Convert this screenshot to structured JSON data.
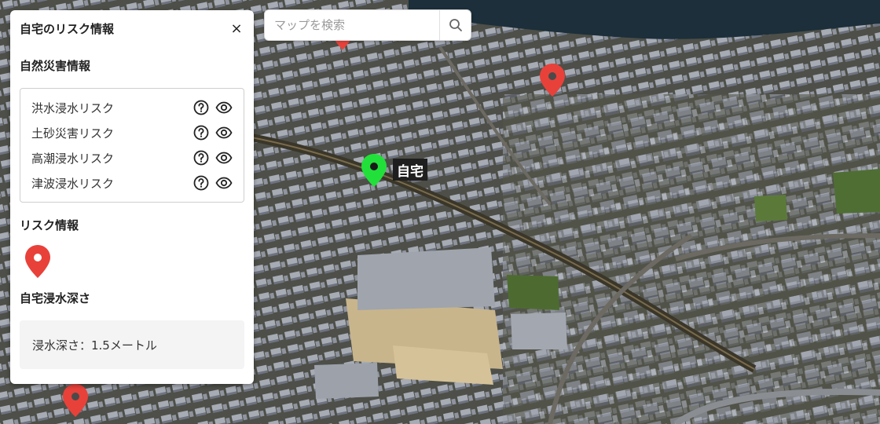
{
  "search": {
    "placeholder": "マップを検索",
    "icon": "search-icon"
  },
  "panel": {
    "title": "自宅のリスク情報",
    "close_label": "×",
    "natural_disaster": {
      "title": "自然災害情報",
      "items": [
        {
          "label": "洪水浸水リスク",
          "icons": [
            "help-icon",
            "eye-icon"
          ]
        },
        {
          "label": "土砂災害リスク",
          "icons": [
            "help-icon",
            "eye-icon"
          ]
        },
        {
          "label": "高潮浸水リスク",
          "icons": [
            "help-icon",
            "eye-icon"
          ]
        },
        {
          "label": "津波浸水リスク",
          "icons": [
            "help-icon",
            "eye-icon"
          ]
        }
      ]
    },
    "risk_info": {
      "title": "リスク情報",
      "marker_icon": "red-map-pin-icon"
    },
    "flood_depth": {
      "title": "自宅浸水深さ",
      "value_text": "浸水深さ：1.5メートル"
    }
  },
  "map": {
    "home_label": "自宅",
    "home_marker_color": "#22e03a",
    "risk_marker_color": "#e8413a",
    "water_color": "#1c2f3a"
  }
}
